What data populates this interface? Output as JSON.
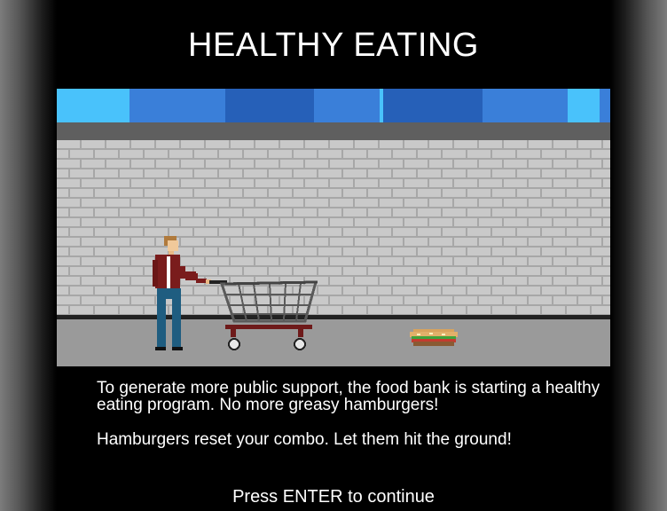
{
  "screen": {
    "title": "HEALTHY EATING",
    "paragraph_1": "To generate more public support, the food bank is starting a healthy eating program. No more greasy hamburgers!",
    "paragraph_2": "Hamburgers reset your combo. Let them hit the ground!",
    "prompt": "Press ENTER to continue"
  },
  "scene": {
    "sky_colors": [
      "#49c2fb",
      "#3a7fd9",
      "#2660b8",
      "#3a7fd9",
      "#2660b8",
      "#3a7fd9",
      "#49c2fb",
      "#3a7fd9"
    ],
    "wall_color": "#c9c9c9",
    "mortar_color": "#a7a7a7",
    "floor_color": "#9a9a9a",
    "character": {
      "jacket_color": "#7a1c1c",
      "pants_color": "#1f5d80",
      "hair_color": "#b07a3c"
    },
    "cart_color": "#5a5a5a",
    "hamburger_icon": "hamburger-icon"
  },
  "colors": {
    "background": "#000000",
    "text": "#ffffff"
  }
}
